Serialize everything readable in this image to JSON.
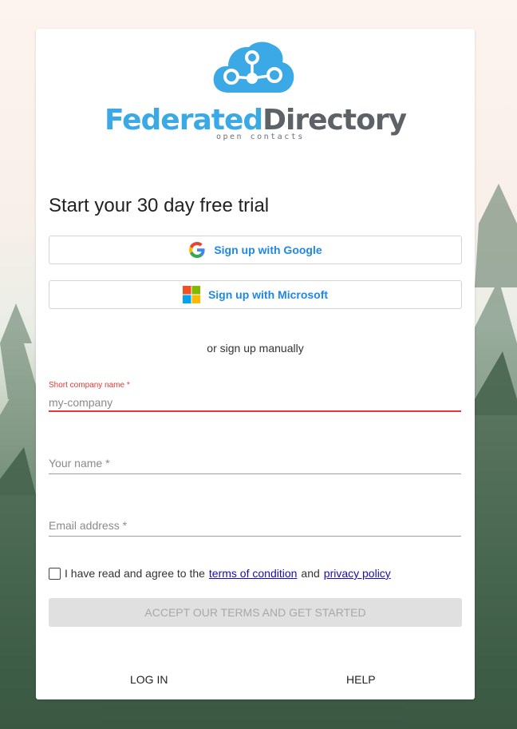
{
  "brand": {
    "name_part1": "Federated",
    "name_part2": "Directory",
    "tagline": "open contacts"
  },
  "title": "Start your 30 day free trial",
  "social": {
    "google_label": "Sign up with Google",
    "microsoft_label": "Sign up with Microsoft"
  },
  "divider_text": "or sign up manually",
  "form": {
    "company": {
      "label": "Short company name *",
      "placeholder": "my-company",
      "value": ""
    },
    "name": {
      "placeholder": "Your name *",
      "value": ""
    },
    "email": {
      "placeholder": "Email address *",
      "value": ""
    }
  },
  "agree": {
    "checked": false,
    "prefix": "I have read and agree to the",
    "terms_link": "terms of condition",
    "middle": "and",
    "privacy_link": "privacy policy"
  },
  "accept_label": "ACCEPT OUR TERMS AND GET STARTED",
  "footer": {
    "login_label": "LOG IN",
    "help_label": "HELP"
  },
  "colors": {
    "accent": "#1e88e5",
    "brand_blue": "#3aa9e6",
    "error": "#e53935",
    "disabled_bg": "#e0e0e0"
  }
}
